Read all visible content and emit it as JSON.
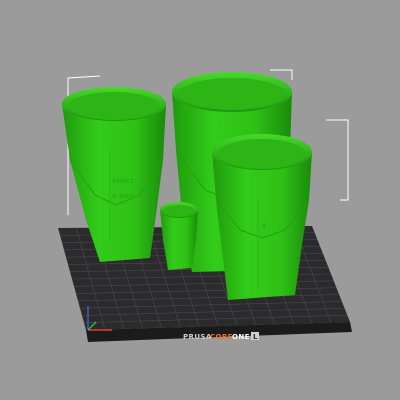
{
  "app": {
    "view": "3D print preview",
    "background_color": "#9b9b9b"
  },
  "build_plate": {
    "brand": "PRUSA",
    "model": "CORE",
    "model_suffix": "ONE",
    "badge": "L",
    "surface_color": "#2b2b2d",
    "grid_color": "#4a4a4c",
    "brand_accent_color": "#e8732c"
  },
  "objects": [
    {
      "name": "Cup left",
      "color": "#33cc1a",
      "label": "SMALL",
      "label_sub": "0.4mm"
    },
    {
      "name": "Cup back",
      "color": "#33cc1a"
    },
    {
      "name": "Cup right",
      "color": "#33cc1a",
      "label": "4"
    },
    {
      "name": "Shot glass",
      "color": "#33cc1a"
    }
  ],
  "axes": {
    "x_color": "#e23b3b",
    "y_color": "#3fb83f",
    "z_color": "#3b5fe2"
  }
}
